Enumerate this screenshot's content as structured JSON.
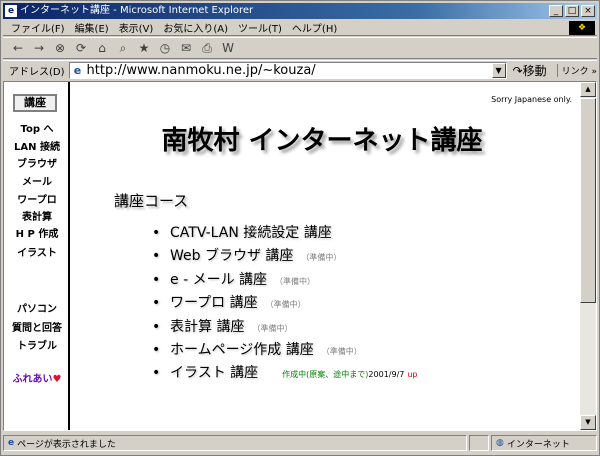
{
  "window": {
    "title": "インターネット講座 - Microsoft Internet Explorer",
    "app_icon": "e",
    "min": "_",
    "max": "□",
    "close": "×"
  },
  "menu": {
    "items": [
      "ファイル(F)",
      "編集(E)",
      "表示(V)",
      "お気に入り(A)",
      "ツール(T)",
      "ヘルプ(H)"
    ],
    "brand": "❖"
  },
  "toolbar": {
    "icons": [
      "back-icon",
      "forward-icon",
      "stop-icon",
      "refresh-icon",
      "home-icon",
      "search-icon",
      "favorites-icon",
      "history-icon",
      "mail-icon",
      "print-icon",
      "edit-icon"
    ],
    "glyphs": [
      "←",
      "→",
      "⊗",
      "⟳",
      "⌂",
      "⌕",
      "★",
      "◷",
      "✉",
      "⎙",
      "W"
    ]
  },
  "address": {
    "label": "アドレス(D)",
    "url": "http://www.nanmoku.ne.jp/~kouza/",
    "page_icon": "e",
    "dropdown": "▼",
    "go_label": "↷移動",
    "links_label": "リンク »"
  },
  "sidebar": {
    "current": "講座",
    "items": [
      "Top へ",
      "LAN 接続",
      "ブラウザ",
      "メール",
      "ワープロ",
      "表計算",
      "H P 作成",
      "イラスト"
    ],
    "items2": [
      "パソコン",
      "質問と回答",
      "トラブル"
    ],
    "love": "ふれあい",
    "heart": "♥"
  },
  "main": {
    "sorry": "Sorry Japanese only.",
    "title": "南牧村 インターネット講座",
    "section_heading": "講座コース",
    "bullet": "•",
    "courses": [
      {
        "name": "CATV-LAN 接続設定 講座",
        "status": ""
      },
      {
        "name": "Web ブラウザ 講座",
        "status": "（準備中）"
      },
      {
        "name": "e - メール 講座",
        "status": "（準備中）"
      },
      {
        "name": "ワープロ 講座",
        "status": "（準備中）"
      },
      {
        "name": "表計算 講座",
        "status": "（準備中）"
      },
      {
        "name": "ホームページ作成 講座",
        "status": "（準備中）"
      },
      {
        "name": "イラスト 講座",
        "status": ""
      }
    ],
    "illust_status": "作成中(原案、途中まで)",
    "illust_date": "2001/9/7",
    "illust_up": "up"
  },
  "scrollbar": {
    "up": "▲",
    "down": "▼"
  },
  "status": {
    "icon": "e",
    "text": "ページが表示されました",
    "zone_icon": "◍",
    "zone": "インターネット"
  }
}
